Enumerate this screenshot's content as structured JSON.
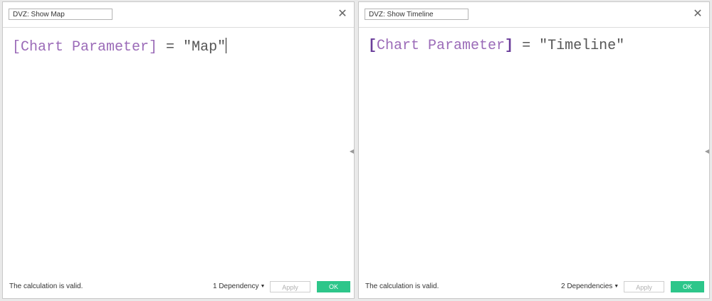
{
  "left_dialog": {
    "name": "DVZ: Show Map",
    "close_glyph": "✕",
    "formula": {
      "field": "[Chart Parameter]",
      "operator": " = ",
      "value": "\"Map\""
    },
    "status": "The calculation is valid.",
    "dependencies": "1 Dependency",
    "apply_label": "Apply",
    "ok_label": "OK"
  },
  "right_dialog": {
    "name": "DVZ: Show Timeline",
    "close_glyph": "✕",
    "formula": {
      "field_open": "[",
      "field_name": "Chart Parameter",
      "field_close": "]",
      "operator": " = ",
      "value": "\"Timeline\""
    },
    "status": "The calculation is valid.",
    "dependencies": "2 Dependencies",
    "apply_label": "Apply",
    "ok_label": "OK"
  },
  "icons": {
    "close": "close-icon",
    "dropdown": "caret-down-icon",
    "collapse": "caret-left-icon"
  },
  "colors": {
    "field": "#9b6bb8",
    "ok_button": "#2dc68a"
  }
}
